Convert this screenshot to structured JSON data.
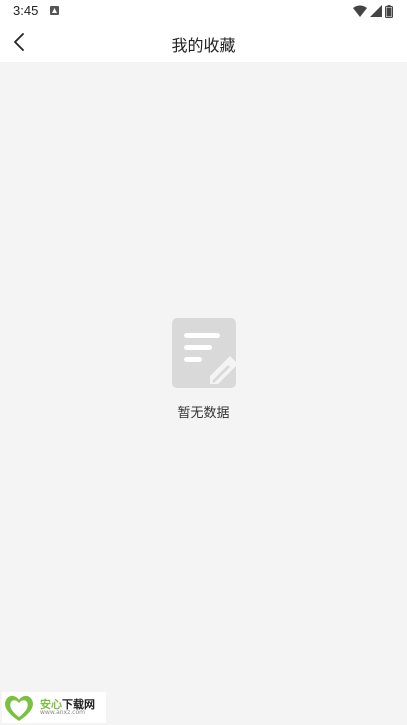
{
  "status_bar": {
    "time": "3:45",
    "icons": [
      "notification-icon",
      "wifi-icon",
      "signal-icon",
      "battery-icon"
    ]
  },
  "header": {
    "back_icon": "chevron-left-icon",
    "title": "我的收藏"
  },
  "empty_state": {
    "icon": "note-edit-icon",
    "message": "暂无数据"
  },
  "watermark": {
    "name_green": "安心",
    "name_rest": "下载网",
    "url": "www.anxz.com"
  },
  "colors": {
    "background": "#f4f4f4",
    "header_bg": "#ffffff",
    "icon_gray": "#d9d9d9",
    "text": "#222222",
    "brand_green": "#7ac142"
  }
}
